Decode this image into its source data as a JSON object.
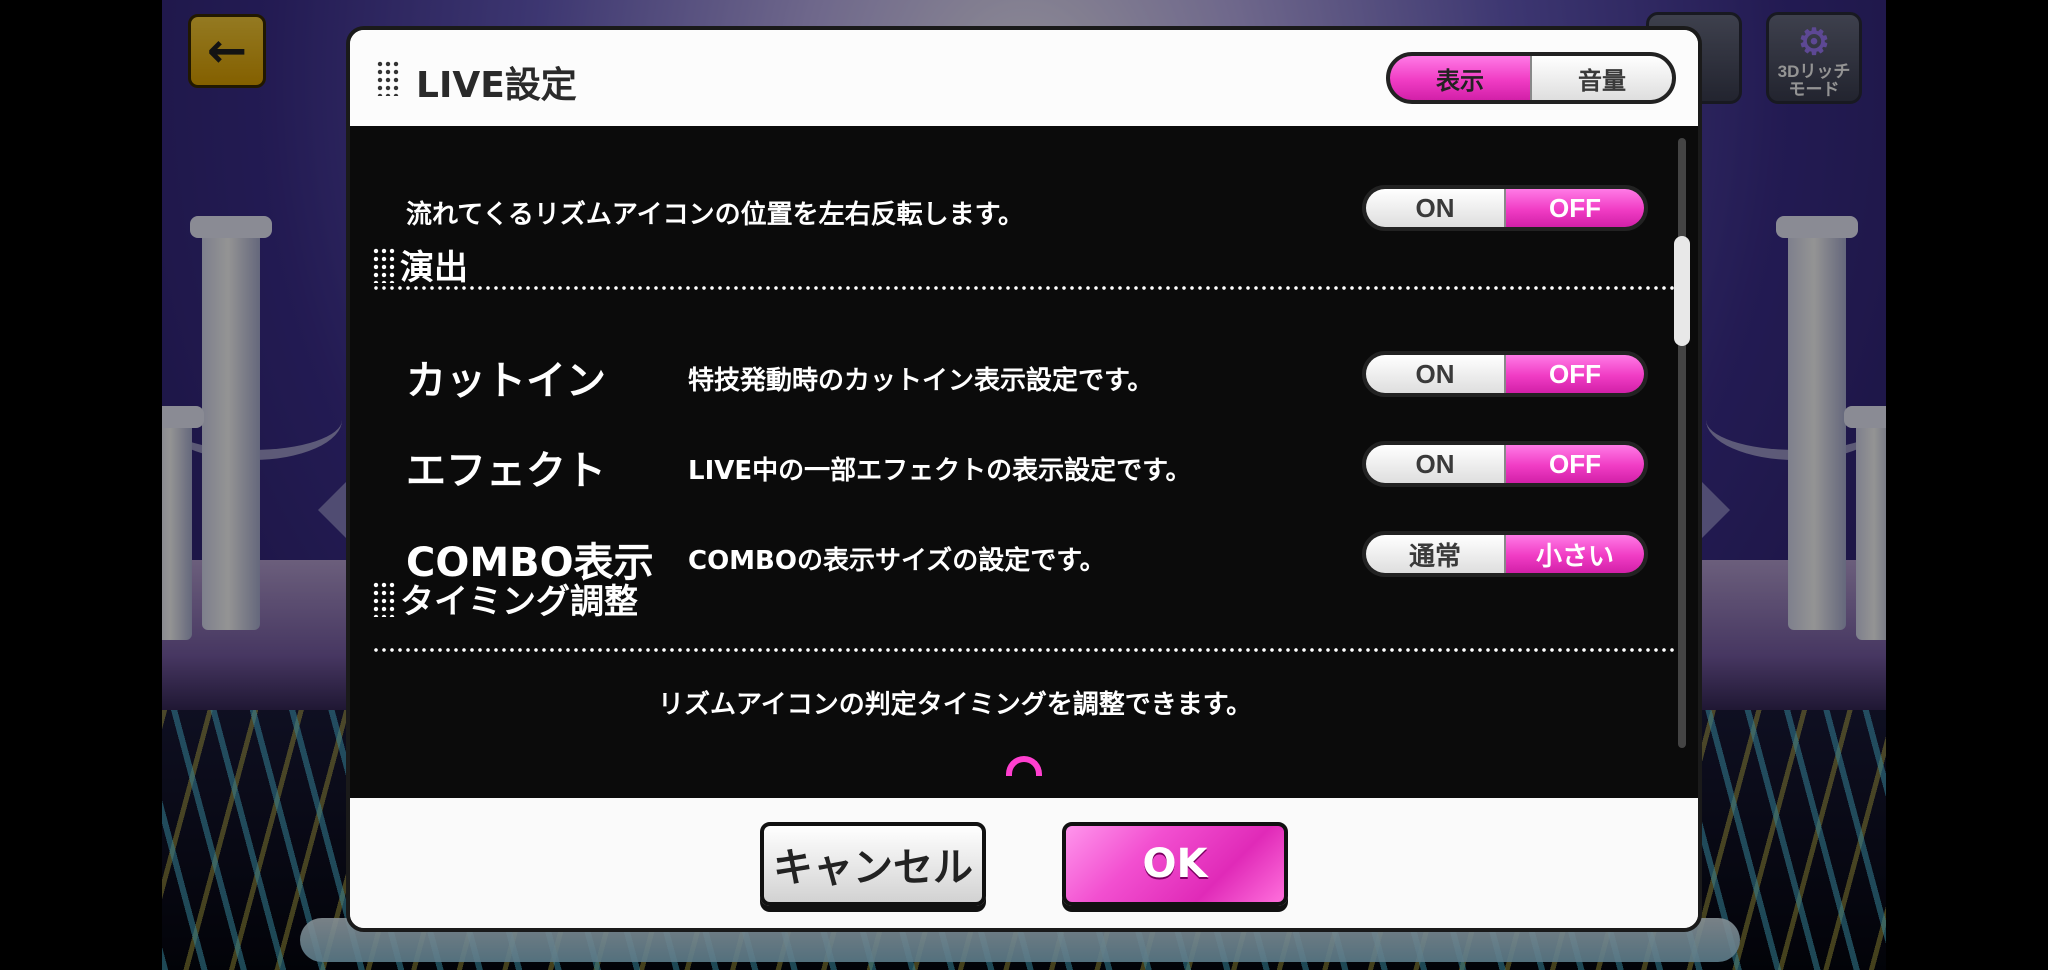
{
  "dialog": {
    "title": "LIVE設定",
    "tabs": [
      {
        "label": "表示",
        "active": true
      },
      {
        "label": "音量",
        "active": false
      }
    ]
  },
  "settings": {
    "mirror_row": {
      "description": "流れてくるリズムアイコンの位置を左右反転します。",
      "options": [
        "ON",
        "OFF"
      ],
      "selected": "OFF"
    },
    "section_effects": {
      "title": "演出"
    },
    "cutin": {
      "name": "カットイン",
      "description": "特技発動時のカットイン表示設定です。",
      "options": [
        "ON",
        "OFF"
      ],
      "selected": "OFF"
    },
    "effect": {
      "name": "エフェクト",
      "description": "LIVE中の一部エフェクトの表示設定です。",
      "options": [
        "ON",
        "OFF"
      ],
      "selected": "OFF"
    },
    "combo": {
      "name": "COMBO表示",
      "description": "COMBOの表示サイズの設定です。",
      "options": [
        "通常",
        "小さい"
      ],
      "selected": "小さい"
    },
    "section_timing": {
      "title": "タイミング調整",
      "description": "リズムアイコンの判定タイミングを調整できます。"
    }
  },
  "footer": {
    "cancel_label": "キャンセル",
    "ok_label": "OK"
  },
  "background": {
    "corner_button_label": "3Dリッチ\nモード"
  },
  "colors": {
    "accent_pink": "#f03cc4",
    "panel_dark": "#0b0b0b",
    "dialog_light": "#fafafa"
  },
  "icons": [
    "back-arrow-icon",
    "gear-icon",
    "dots-grip-icon",
    "scroll-more-icon"
  ]
}
